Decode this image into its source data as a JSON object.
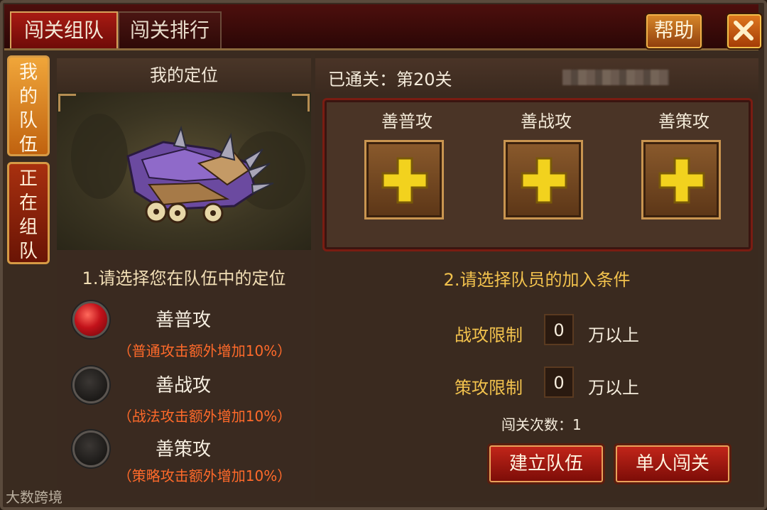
{
  "tabs": {
    "team": "闯关组队",
    "ranking": "闯关排行"
  },
  "help_label": "帮助",
  "side_tabs": {
    "my_team": [
      "我",
      "的",
      "队",
      "伍"
    ],
    "teaming": [
      "正",
      "在",
      "组",
      "队"
    ]
  },
  "left": {
    "header": "我的定位",
    "instruction": "1.请选择您在队伍中的定位",
    "options": [
      {
        "label": "善普攻",
        "desc": "（普通攻击额外增加10%）",
        "selected": true
      },
      {
        "label": "善战攻",
        "desc": "（战法攻击额外增加10%）",
        "selected": false
      },
      {
        "label": "善策攻",
        "desc": "（策略攻击额外增加10%）",
        "selected": false
      }
    ]
  },
  "right": {
    "cleared": "已通关：第20关",
    "roles": [
      "善普攻",
      "善战攻",
      "善策攻"
    ],
    "instruction": "2.请选择队员的加入条件",
    "limits": [
      {
        "label": "战攻限制",
        "value": "0",
        "suffix": "万以上"
      },
      {
        "label": "策攻限制",
        "value": "0",
        "suffix": "万以上"
      }
    ],
    "count": "闯关次数：1",
    "buttons": {
      "create": "建立队伍",
      "solo": "单人闯关"
    }
  },
  "watermark": "大数跨境"
}
